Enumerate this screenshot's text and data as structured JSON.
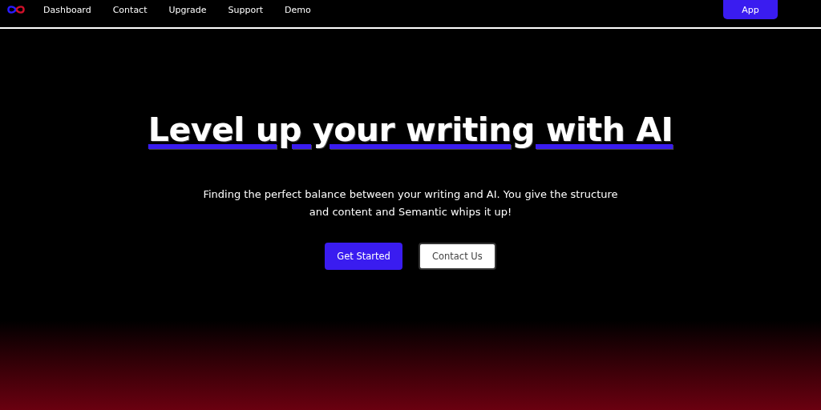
{
  "nav": {
    "links": [
      "Dashboard",
      "Contact",
      "Upgrade",
      "Support",
      "Demo"
    ],
    "app_button": "App"
  },
  "hero": {
    "title": "Level up your writing with AI",
    "subtitle": "Finding the perfect balance between your writing and AI. You give the structure and content and Semantic whips it up!",
    "buttons": [
      {
        "label": "Get Started",
        "kind": "primary"
      },
      {
        "label": "Contact Us",
        "kind": "secondary"
      }
    ]
  }
}
